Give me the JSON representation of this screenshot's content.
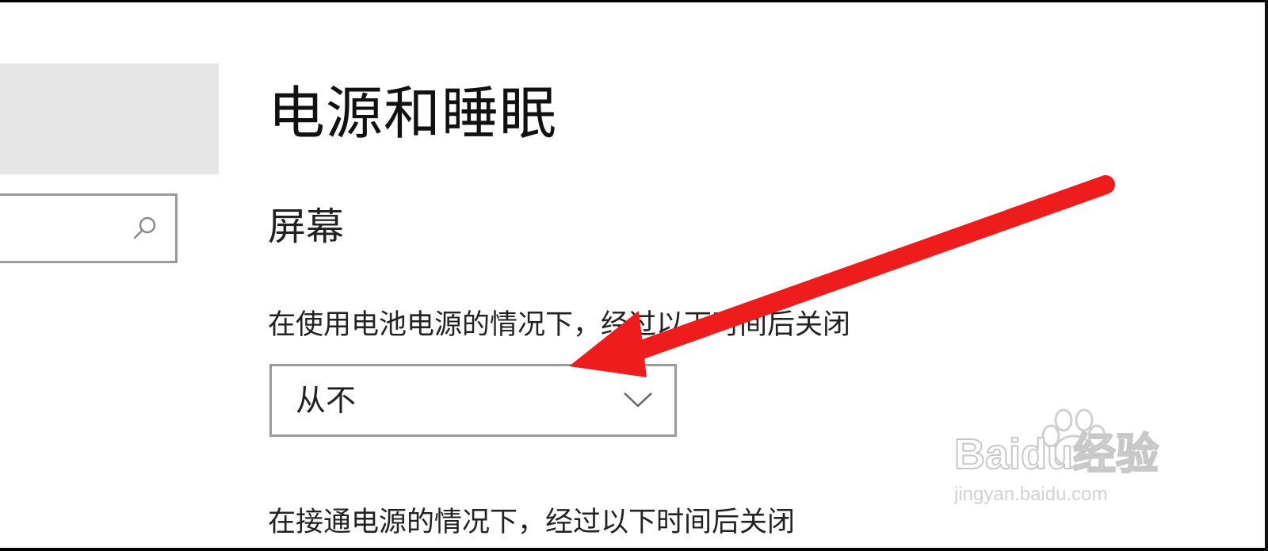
{
  "settings": {
    "page_title": "电源和睡眠",
    "section_title": "屏幕",
    "battery_label": "在使用电池电源的情况下，经过以下时间后关闭",
    "battery_dropdown_value": "从不",
    "plugged_label": "在接通电源的情况下，经过以下时间后关闭"
  },
  "sidebar": {
    "search_icon": "search-icon"
  },
  "annotation": {
    "arrow_color": "#ee1c1c"
  },
  "watermark": {
    "brand": "Baidu经验",
    "url": "jingyan.baidu.com"
  },
  "colors": {
    "sidebar_block": "#e6e6e6",
    "border": "#9a9a9a",
    "text": "#222222"
  }
}
